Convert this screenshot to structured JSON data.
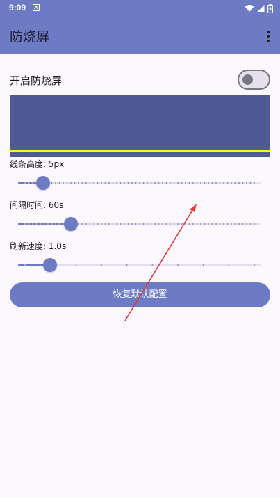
{
  "status_bar": {
    "time": "9:09",
    "notification_icon": "A",
    "icons": [
      "wifi-icon",
      "signal-icon",
      "battery-charging-icon"
    ]
  },
  "app_bar": {
    "title": "防烧屏",
    "menu_icon": "more-vert-icon"
  },
  "toggle": {
    "label": "开启防烧屏",
    "checked": false
  },
  "preview": {
    "background_color": "#4d5a93",
    "line_color": "#ffff00"
  },
  "sliders": [
    {
      "label": "线条高度: 5px",
      "fraction": 0.08,
      "ticks": 60
    },
    {
      "label": "间隔时间: 60s",
      "fraction": 0.2,
      "ticks": 60
    },
    {
      "label": "刷新速度: 1.0s",
      "fraction": 0.11,
      "ticks": 9
    }
  ],
  "reset_button": {
    "label": "恢复默认配置"
  },
  "colors": {
    "primary": "#6d7bc4",
    "annotation_arrow": "#e03a3a"
  }
}
